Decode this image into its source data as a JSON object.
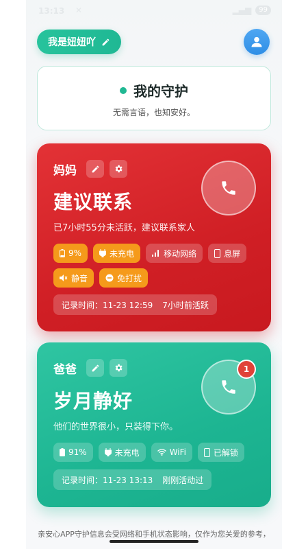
{
  "status_bar": {
    "time": "13:13",
    "battery": "99"
  },
  "header": {
    "nickname": "我是妞妞吖"
  },
  "guard": {
    "title": "我的守护",
    "subtitle": "无需言语，也知安好。"
  },
  "cards": [
    {
      "name": "妈妈",
      "status": "建议联系",
      "description": "已7小时55分未活跃，建议联系家人",
      "chips": [
        {
          "icon": "battery-low-icon",
          "label": "9%",
          "warn": true
        },
        {
          "icon": "plug-icon",
          "label": "未充电",
          "warn": true
        },
        {
          "icon": "signal-bars-icon",
          "label": "移动网络",
          "warn": false
        },
        {
          "icon": "phone-device-icon",
          "label": "息屏",
          "warn": false
        },
        {
          "icon": "mute-icon",
          "label": "静音",
          "warn": true
        },
        {
          "icon": "do-not-disturb-icon",
          "label": "免打扰",
          "warn": true
        }
      ],
      "record_time": "记录时间：11-23 12:59",
      "record_ago": "7小时前活跃",
      "color": "#d8242a"
    },
    {
      "name": "爸爸",
      "status": "岁月静好",
      "description": "他们的世界很小，只装得下你。",
      "badge": "1",
      "chips": [
        {
          "icon": "battery-full-icon",
          "label": "91%",
          "warn": false
        },
        {
          "icon": "plug-icon",
          "label": "未充电",
          "warn": false
        },
        {
          "icon": "wifi-icon",
          "label": "WiFi",
          "warn": false
        },
        {
          "icon": "phone-device-icon",
          "label": "已解锁",
          "warn": false
        }
      ],
      "record_time": "记录时间：11-23 13:13",
      "record_ago": "刚刚活动过",
      "color": "#1fb894"
    }
  ],
  "footer": {
    "note": "亲安心APP守护信息会受网络和手机状态影响，仅作为您关爱的参考，"
  },
  "colors": {
    "accent_green": "#1fb894",
    "alert_red": "#d8242a",
    "warn_orange": "#f59a1b",
    "avatar_blue": "#2e8ee6"
  }
}
